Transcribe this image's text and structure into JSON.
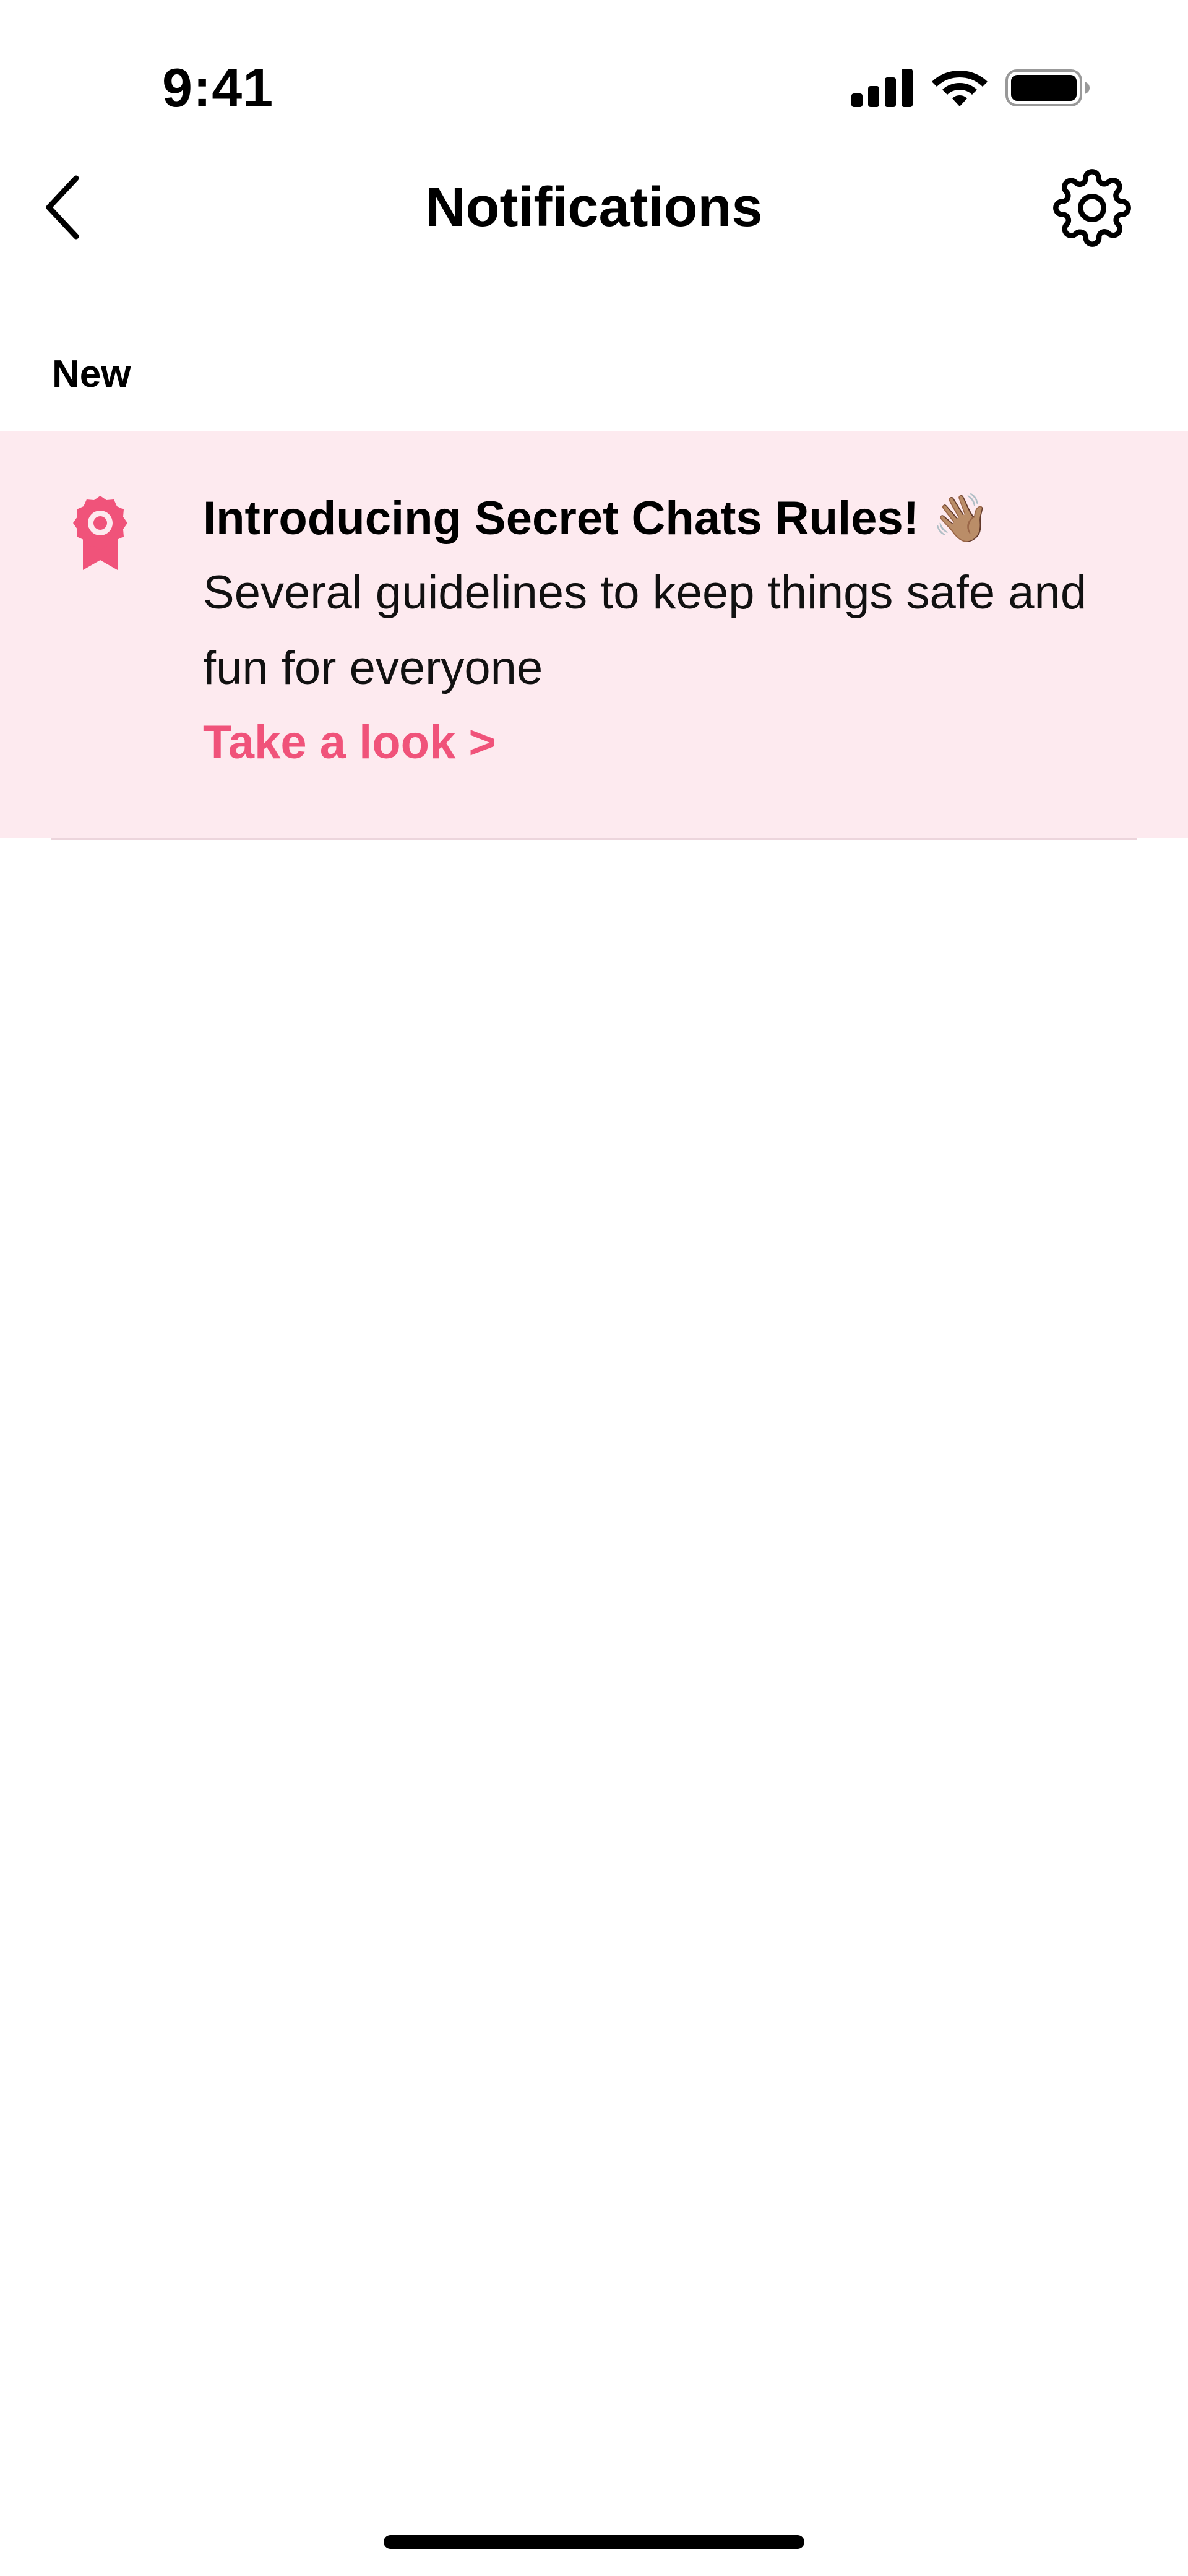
{
  "status_bar": {
    "time": "9:41",
    "icons": [
      "cellular-signal-icon",
      "wifi-icon",
      "battery-icon"
    ]
  },
  "nav": {
    "back_icon": "chevron-left-icon",
    "title": "Notifications",
    "settings_icon": "gear-icon"
  },
  "sections": {
    "new_label": "New"
  },
  "notification": {
    "icon": "award-ribbon-icon",
    "title": "Introducing Secret Chats Rules! 👋🏽",
    "body": "Several guidelines to keep things safe and fun for everyone",
    "link": "Take a look >"
  },
  "colors": {
    "accent": "#f0537a",
    "card_background": "#fdeaef",
    "divider": "#ecd5dc"
  }
}
